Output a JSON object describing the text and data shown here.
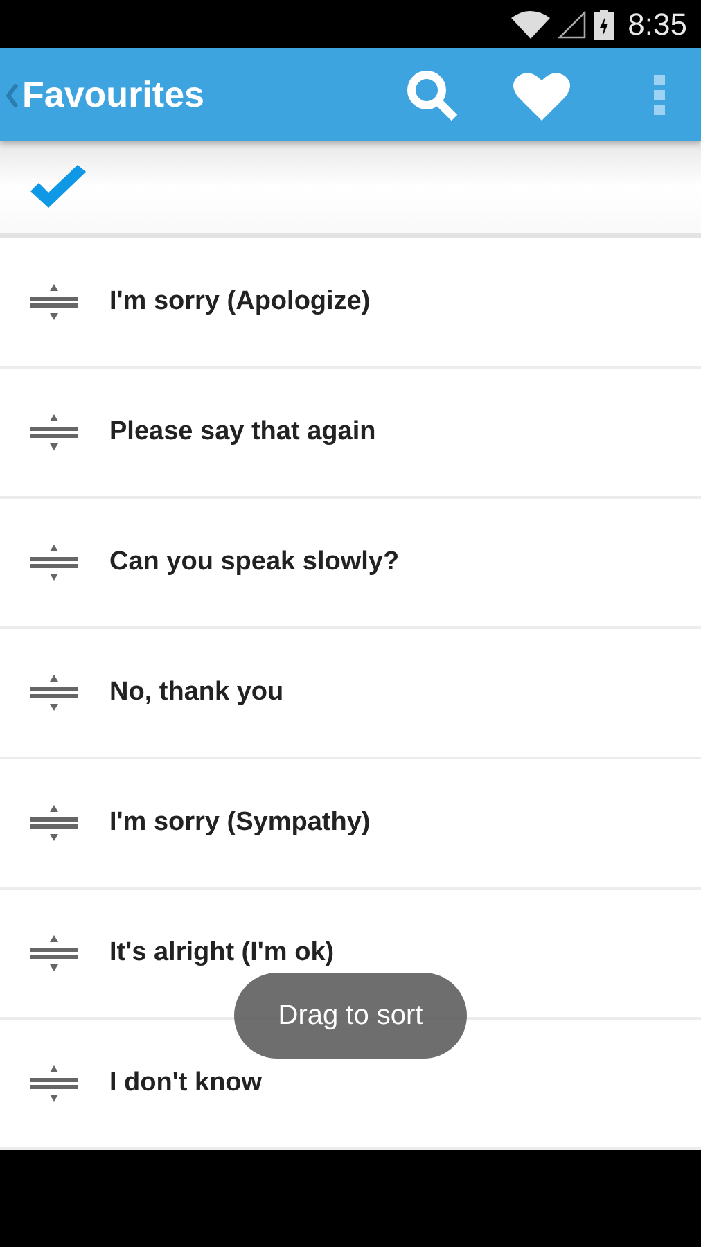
{
  "status_bar": {
    "time": "8:35"
  },
  "app_bar": {
    "title": "Favourites"
  },
  "items": [
    {
      "label": "I'm sorry (Apologize)"
    },
    {
      "label": "Please say that again"
    },
    {
      "label": "Can you speak slowly?"
    },
    {
      "label": "No, thank you"
    },
    {
      "label": "I'm sorry (Sympathy)"
    },
    {
      "label": "It's alright (I'm ok)"
    },
    {
      "label": "I don't know"
    }
  ],
  "toast": {
    "text": "Drag to sort"
  }
}
